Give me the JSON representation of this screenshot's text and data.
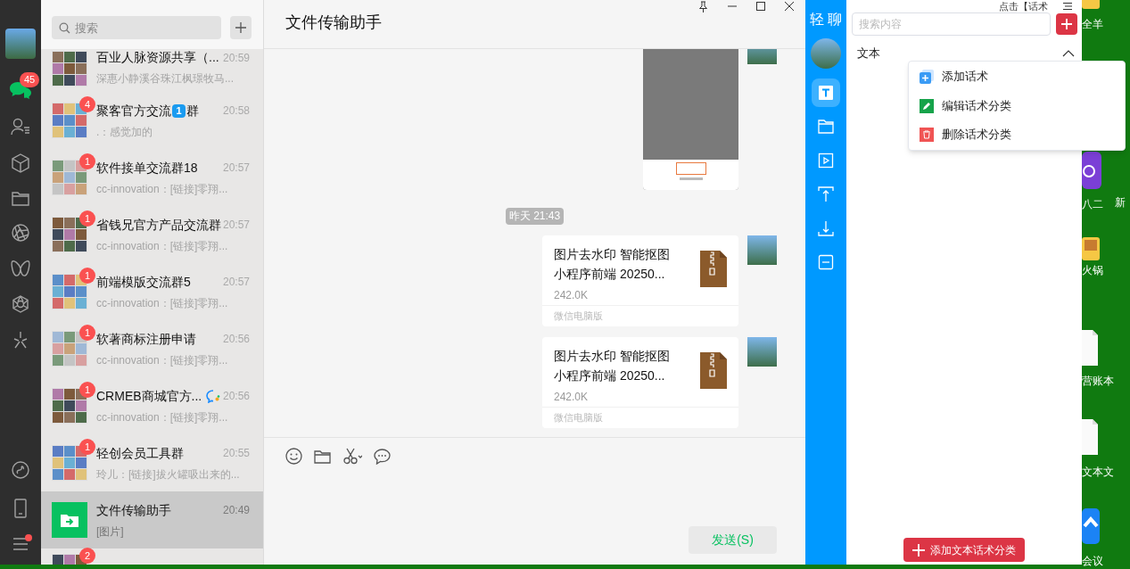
{
  "nav": {
    "items": [
      {
        "kind": "chat",
        "selected": true,
        "badge": "45"
      },
      {
        "kind": "contacts",
        "selected": false
      },
      {
        "kind": "cube",
        "selected": false
      },
      {
        "kind": "folder",
        "selected": false
      },
      {
        "kind": "aperture",
        "selected": false
      },
      {
        "kind": "butterfly",
        "selected": false
      },
      {
        "kind": "hexagon",
        "selected": false
      },
      {
        "kind": "sparkle",
        "selected": false
      }
    ],
    "bottom": [
      {
        "kind": "link"
      },
      {
        "kind": "phone"
      },
      {
        "kind": "menu",
        "dot": true
      }
    ]
  },
  "chat_list": {
    "search_placeholder": "搜索",
    "items": [
      {
        "kind": "group",
        "title": "百业人脉资源共享（...",
        "preview": "深惠小静溪谷珠江枫璟牧马...",
        "time": "20:59",
        "selected": false
      },
      {
        "kind": "group",
        "title": "聚客官方交流",
        "keycap": "1",
        "title_end": "群",
        "preview": ".：感觉加的",
        "time": "20:58",
        "badge": "4",
        "selected": false
      },
      {
        "kind": "group",
        "title": "软件接单交流群18",
        "preview": "cc-innovation：[链接]零翔...",
        "time": "20:57",
        "badge": "1",
        "selected": false
      },
      {
        "kind": "group",
        "title": "省钱兄官方产品交流群",
        "preview": "cc-innovation：[链接]零翔...",
        "time": "20:57",
        "badge": "1",
        "selected": false
      },
      {
        "kind": "group",
        "title": "前端模版交流群5",
        "preview": "cc-innovation：[链接]零翔...",
        "time": "20:57",
        "badge": "1",
        "selected": false
      },
      {
        "kind": "group",
        "title": "软著商标注册申请",
        "preview": "cc-innovation：[链接]零翔...",
        "time": "20:56",
        "badge": "1",
        "selected": false
      },
      {
        "kind": "group",
        "title": "CRMEB商城官方...",
        "tagged": true,
        "preview": "cc-innovation：[链接]零翔...",
        "time": "20:56",
        "badge": "1",
        "selected": false
      },
      {
        "kind": "group",
        "title": "轻创会员工具群",
        "preview": "玲儿：[链接]拔火罐吸出来的...",
        "time": "20:55",
        "badge": "1",
        "selected": false
      },
      {
        "kind": "file",
        "title": "文件传输助手",
        "preview": "[图片]",
        "time": "20:49",
        "selected": true
      },
      {
        "kind": "group",
        "badge": "2",
        "selected": false
      }
    ]
  },
  "chat": {
    "title": "文件传输助手",
    "messages": [
      {
        "kind": "image"
      },
      {
        "kind": "time",
        "text": "昨天 21:43"
      },
      {
        "kind": "file",
        "name": "图片去水印 智能抠图小程序前端 20250...",
        "size": "242.0K",
        "source": "微信电脑版"
      },
      {
        "kind": "file",
        "name": "图片去水印 智能抠图小程序前端 20250...",
        "size": "242.0K",
        "source": "微信电脑版"
      }
    ],
    "toolbar": [
      {
        "kind": "emoji"
      },
      {
        "kind": "folder"
      },
      {
        "kind": "scissors"
      },
      {
        "kind": "bubble"
      }
    ],
    "send_button": "发送(S)"
  },
  "sidebar": {
    "title": "轻 聊",
    "tools": [
      {
        "kind": "text",
        "selected": true
      },
      {
        "kind": "folder",
        "selected": false
      },
      {
        "kind": "video",
        "selected": false
      },
      {
        "kind": "upload",
        "selected": false
      },
      {
        "kind": "download",
        "selected": false
      },
      {
        "kind": "minus",
        "selected": false
      }
    ]
  },
  "panel": {
    "hint": "点击【话术",
    "search_placeholder": "搜索内容",
    "category": {
      "label": "文本",
      "expanded": true
    },
    "menu": [
      {
        "kind": "add",
        "label": "添加话术"
      },
      {
        "kind": "edit",
        "label": "编辑话术分类"
      },
      {
        "kind": "delete",
        "label": "删除话术分类"
      }
    ],
    "add_category_button": "添加文本话术分类"
  },
  "desktop": {
    "icons": [
      {
        "kind": "yellow",
        "label": "全羊"
      },
      {
        "kind": "purple",
        "label": "八二"
      },
      {
        "label": "新"
      },
      {
        "kind": "food",
        "label": "火锅"
      },
      {
        "kind": "doc",
        "label": "营账本"
      },
      {
        "kind": "doc",
        "label": "文本文"
      },
      {
        "kind": "blue",
        "label": "会议"
      }
    ]
  }
}
